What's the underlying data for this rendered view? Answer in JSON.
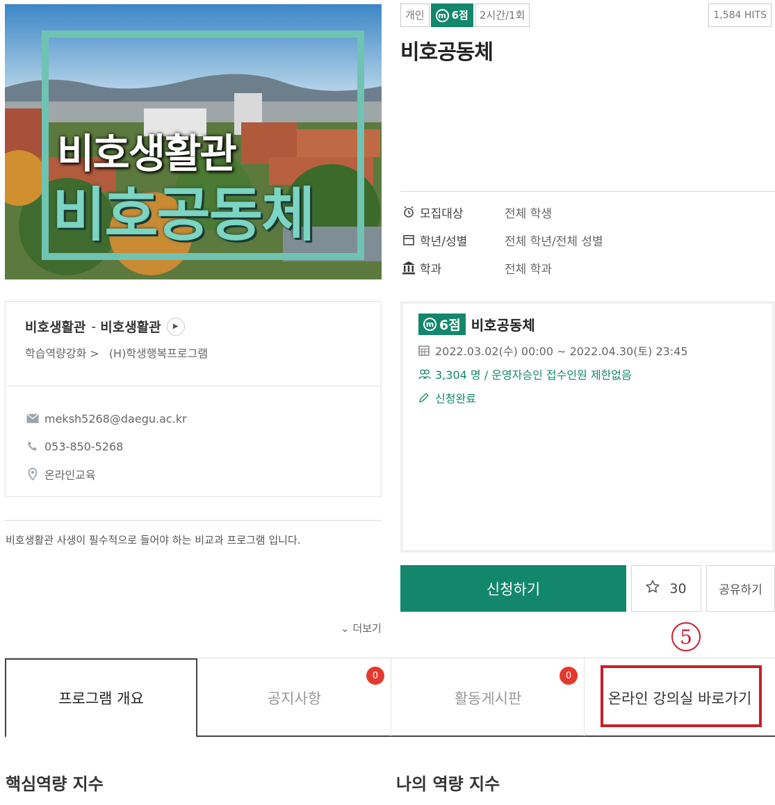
{
  "hero": {
    "line1": "비호생활관",
    "line2": "비호공동체",
    "frame_color": "#6fc3b2"
  },
  "header": {
    "type_badge": "개인",
    "points_badge": "6점",
    "duration_badge": "2시간/1회",
    "hits": "1,584 HITS",
    "title": "비호공동체"
  },
  "info": [
    {
      "icon": "alarm-clock-icon",
      "label": "모집대상",
      "value": "전체 학생"
    },
    {
      "icon": "calendar-icon",
      "label": "학년/성별",
      "value": "전체 학년/전체 성별"
    },
    {
      "icon": "building-icon",
      "label": "학과",
      "value": "전체 학과"
    }
  ],
  "host": {
    "name": "비호생활관",
    "separator": "-",
    "dept": "비호생활관",
    "category1": "학습역량강화 >",
    "category2": "(H)학생행복프로그램"
  },
  "contacts": {
    "email": "meksh5268@daegu.ac.kr",
    "phone": "053-850-5268",
    "location": "온라인교육"
  },
  "description": "비호생활관 사생이 필수적으로 들어야 하는 비교과 프로그램 입니다.",
  "more_label": "더보기",
  "session": {
    "points": "6점",
    "title": "비호공동체",
    "period": "2022.03.02(수) 00:00 ~ 2022.04.30(토) 23:45",
    "enrolled": "3,304 명",
    "approval": "/ 운영자승인 접수인원 제한없음",
    "status": "신청완료"
  },
  "actions": {
    "apply": "신청하기",
    "favorites": "30",
    "share": "공유하기"
  },
  "annotation_step": "5",
  "tabs": [
    {
      "label": "프로그램 개요",
      "active": true
    },
    {
      "label": "공지사항",
      "count": "0"
    },
    {
      "label": "활동게시판",
      "count": "0"
    },
    {
      "label": "온라인 강의실 바로가기"
    }
  ],
  "sections": {
    "left": "핵심역량 지수",
    "right": "나의 역량 지수"
  },
  "colors": {
    "brand_green": "#13876c",
    "highlight_red": "#c81e2b",
    "badge_red": "#e5392e"
  }
}
